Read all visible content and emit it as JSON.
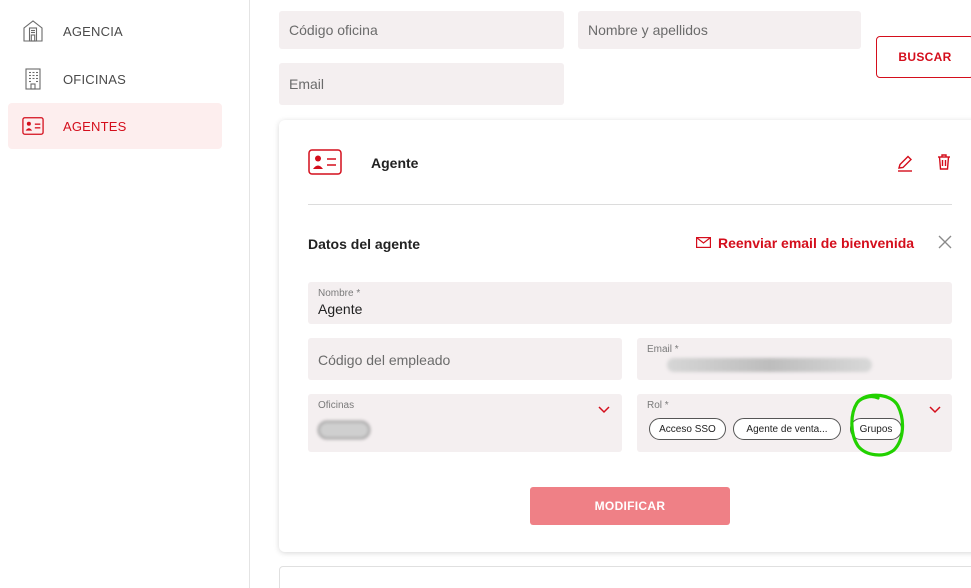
{
  "sidebar": {
    "items": [
      {
        "label": "AGENCIA",
        "icon": "building-icon",
        "active": false
      },
      {
        "label": "OFICINAS",
        "icon": "office-building-icon",
        "active": false
      },
      {
        "label": "AGENTES",
        "icon": "id-card-icon",
        "active": true
      }
    ]
  },
  "search": {
    "office_code_placeholder": "Código oficina",
    "name_placeholder": "Nombre y apellidos",
    "email_placeholder": "Email",
    "search_button": "BUSCAR"
  },
  "card": {
    "title": "Agente",
    "section_title": "Datos del agente",
    "resend_email": "Reenviar email de bienvenida",
    "fields": {
      "nombre_label": "Nombre *",
      "nombre_value": "Agente",
      "employee_code_placeholder": "Código del empleado",
      "email_label": "Email *",
      "oficinas_label": "Oficinas",
      "rol_label": "Rol *"
    },
    "roles": [
      "Acceso SSO",
      "Agente de venta...",
      "Grupos"
    ],
    "submit_button": "MODIFICAR"
  },
  "colors": {
    "accent": "#d40e1c",
    "active_bg": "#fdeeee",
    "field_bg": "#f4eff0",
    "button_disabled": "#ef8086",
    "annotation": "#22d100"
  }
}
